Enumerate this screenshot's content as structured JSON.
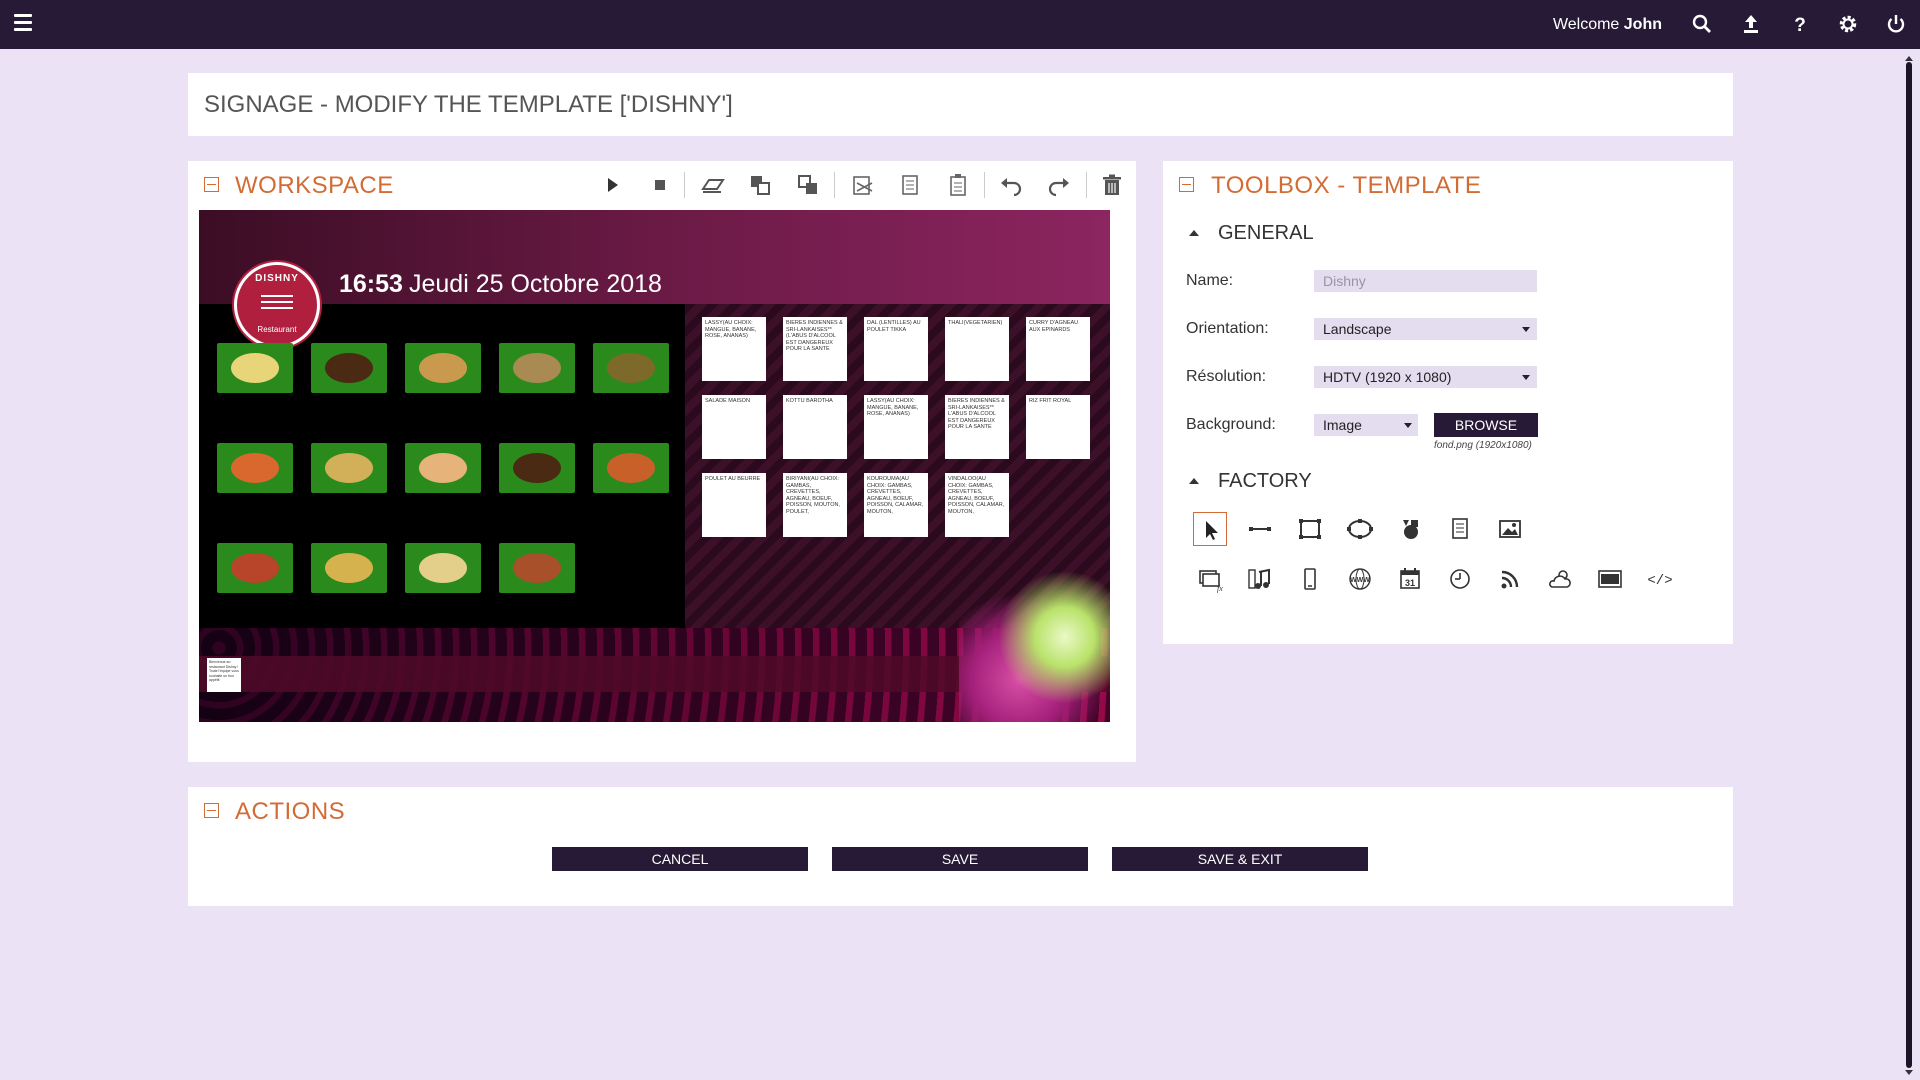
{
  "topbar": {
    "welcome_prefix": "Welcome",
    "user_name": "John",
    "icons": [
      "search-icon",
      "upload-icon",
      "help-icon",
      "gear-icon",
      "power-icon"
    ]
  },
  "page_title": "SIGNAGE - MODIFY THE TEMPLATE ['DISHNY']",
  "workspace": {
    "title": "WORKSPACE",
    "toolbar_icons": [
      "play-icon",
      "stop-icon",
      "eraser-icon",
      "bring-forward-icon",
      "send-backward-icon",
      "cut-icon",
      "copy-icon",
      "paste-icon",
      "undo-icon",
      "redo-icon",
      "trash-icon"
    ],
    "canvas": {
      "time": "16:53",
      "date": "Jeudi 25 Octobre 2018",
      "logo_name": "DISHNY",
      "logo_sub": "Restaurant",
      "menu_cards": [
        "LASSY(AU CHOIX: MANGUE, BANANE, ROSE, ANANAS)",
        "BIERES INDIENNES & SRI-LANKAISES**(L'ABUS D'ALCOOL EST DANGEREUX POUR LA SANTE",
        "DAL (LENTILLES) AU POULET TIKKA",
        "THALI(VEGETARIEN)",
        "CURRY D'AGNEAU AUX EPINARDS",
        "SALADE MAISON",
        "KOTTU BAROTHA",
        "LASSY(AU CHOIX: MANGUE, BANANE, ROSE, ANANAS)",
        "BIERES INDIENNES & SRI-LANKAISES** L'ABUS D'ALCOOL EST DANGEREUX POUR LA SANTE",
        "RIZ FRIT ROYAL",
        "POULET AU BEURRE",
        "BIRIYANI(AU CHOIX: GAMBAS, CREVETTES, AGNEAU, BOEUF, POISSON, MOUTON, POULET,",
        "KOUROUMA(AU CHOIX: GAMBAS, CREVETTES, AGNEAU, BOEUF, POISSON, CALAMAR, MOUTON,",
        "VINDALOO(AU CHOIX: GAMBAS, CREVETTES, AGNEAU, BOEUF, POISSON, CALAMAR, MOUTON,"
      ],
      "note_text": "Bienvenue au restaurant Dishny ! Toute l'équipe vous souhaite un bon appétit"
    }
  },
  "toolbox": {
    "title": "TOOLBOX - TEMPLATE",
    "general": {
      "title": "GENERAL",
      "name_label": "Name:",
      "name_placeholder": "Dishny",
      "orientation_label": "Orientation:",
      "orientation_value": "Landscape",
      "resolution_label": "Résolution:",
      "resolution_value": "HDTV (1920 x 1080)",
      "background_label": "Background:",
      "background_value": "Image",
      "browse_label": "BROWSE",
      "background_file": "fond.png (1920x1080)"
    },
    "factory": {
      "title": "FACTORY",
      "tools": [
        "pointer-icon",
        "line-icon",
        "rectangle-icon",
        "ellipse-icon",
        "shapes-icon",
        "text-icon",
        "image-icon",
        "fx-icon",
        "music-icon",
        "mobile-icon",
        "web-icon",
        "calendar-icon",
        "clock-icon",
        "rss-icon",
        "weather-icon",
        "video-icon",
        "code-icon"
      ],
      "calendar_day": "31",
      "code_glyph": "</>",
      "web_glyph": "WWW"
    }
  },
  "actions": {
    "title": "ACTIONS",
    "cancel": "CANCEL",
    "save": "SAVE",
    "save_exit": "SAVE & EXIT"
  },
  "colors": {
    "accent": "#d36c34",
    "dark": "#261a37",
    "background": "#ebe2f5"
  }
}
